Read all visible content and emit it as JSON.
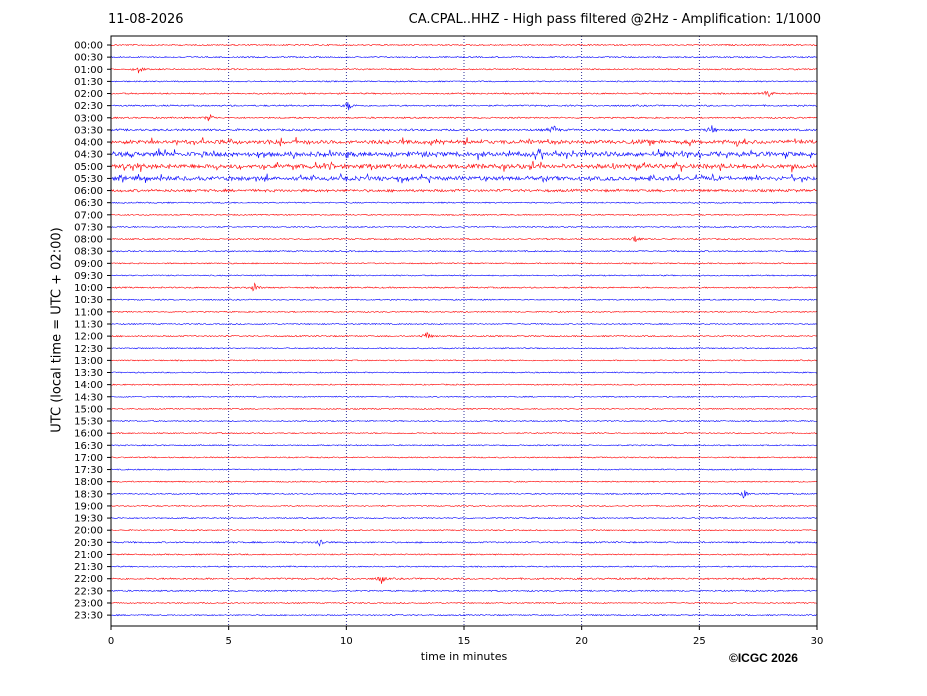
{
  "header": {
    "date": "11-08-2026",
    "title": "CA.CPAL..HHZ - High pass filtered @2Hz - Amplification: 1/1000"
  },
  "footer": {
    "copyright": "©ICGC 2026"
  },
  "chart_data": {
    "type": "line",
    "subtype": "helicorder",
    "ylabel": "UTC (local time = UTC + 02:00)",
    "xlabel": "time in minutes",
    "xlim": [
      0,
      30
    ],
    "x_ticks": [
      0,
      5,
      10,
      15,
      20,
      25,
      30
    ],
    "grid": "vertical dotted at 5-minute ticks",
    "row_labels": [
      "00:00",
      "00:30",
      "01:00",
      "01:30",
      "02:00",
      "02:30",
      "03:00",
      "03:30",
      "04:00",
      "04:30",
      "05:00",
      "05:30",
      "06:00",
      "06:30",
      "07:00",
      "07:30",
      "08:00",
      "08:30",
      "09:00",
      "09:30",
      "10:00",
      "10:30",
      "11:00",
      "11:30",
      "12:00",
      "12:30",
      "13:00",
      "13:30",
      "14:00",
      "14:30",
      "15:00",
      "15:30",
      "16:00",
      "16:30",
      "17:00",
      "17:30",
      "18:00",
      "18:30",
      "19:00",
      "19:30",
      "20:00",
      "20:30",
      "21:00",
      "21:30",
      "22:00",
      "22:30",
      "23:00",
      "23:30"
    ],
    "trace_colors": [
      "#ff0000",
      "#0000ff"
    ],
    "row_activity": [
      0.08,
      0.1,
      0.1,
      0.06,
      0.12,
      0.15,
      0.12,
      0.3,
      0.85,
      1.0,
      1.0,
      0.85,
      0.45,
      0.08,
      0.05,
      0.05,
      0.1,
      0.1,
      0.05,
      0.05,
      0.12,
      0.05,
      0.05,
      0.05,
      0.1,
      0.05,
      0.05,
      0.05,
      0.05,
      0.05,
      0.05,
      0.05,
      0.05,
      0.05,
      0.05,
      0.05,
      0.05,
      0.08,
      0.05,
      0.05,
      0.05,
      0.15,
      0.08,
      0.05,
      0.2,
      0.1,
      0.05,
      0.05
    ],
    "events": [
      {
        "row": "01:00",
        "minute": 1.2
      },
      {
        "row": "02:00",
        "minute": 27.9
      },
      {
        "row": "02:30",
        "minute": 10.1
      },
      {
        "row": "03:00",
        "minute": 4.2
      },
      {
        "row": "03:30",
        "minute": 25.5
      },
      {
        "row": "03:30",
        "minute": 18.8
      },
      {
        "row": "08:00",
        "minute": 22.3
      },
      {
        "row": "10:00",
        "minute": 6.1
      },
      {
        "row": "12:00",
        "minute": 13.4
      },
      {
        "row": "18:30",
        "minute": 26.9
      },
      {
        "row": "20:30",
        "minute": 8.9
      },
      {
        "row": "22:00",
        "minute": 11.5
      }
    ]
  }
}
